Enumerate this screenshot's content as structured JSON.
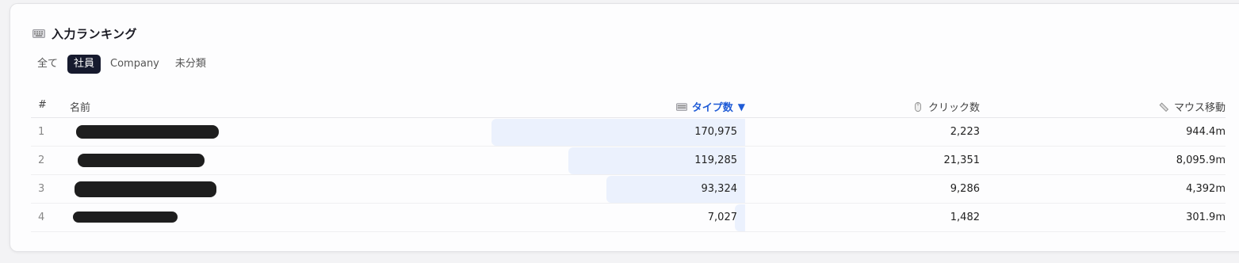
{
  "panel": {
    "title": "入力ランキング",
    "title_icon": "keyboard-icon"
  },
  "tabs": [
    {
      "label": "全て",
      "active": false
    },
    {
      "label": "社員",
      "active": true
    },
    {
      "label": "Company",
      "active": false
    },
    {
      "label": "未分類",
      "active": false
    }
  ],
  "columns": {
    "rank": "#",
    "name": "名前",
    "types": "タイプ数",
    "types_sort_indicator": "▼",
    "clicks": "クリック数",
    "mouse": "マウス移動"
  },
  "rows": [
    {
      "rank": "1",
      "types": "170,975",
      "types_value": 170975,
      "clicks": "2,223",
      "mouse": "944.4m"
    },
    {
      "rank": "2",
      "types": "119,285",
      "types_value": 119285,
      "clicks": "21,351",
      "mouse": "8,095.9m"
    },
    {
      "rank": "3",
      "types": "93,324",
      "types_value": 93324,
      "clicks": "9,286",
      "mouse": "4,392m"
    },
    {
      "rank": "4",
      "types": "7,027",
      "types_value": 7027,
      "clicks": "1,482",
      "mouse": "301.9m"
    }
  ],
  "colors": {
    "accent": "#1f5bd6",
    "active_tab_bg": "#161a2e",
    "bar_fill": "#ebf1fd"
  }
}
